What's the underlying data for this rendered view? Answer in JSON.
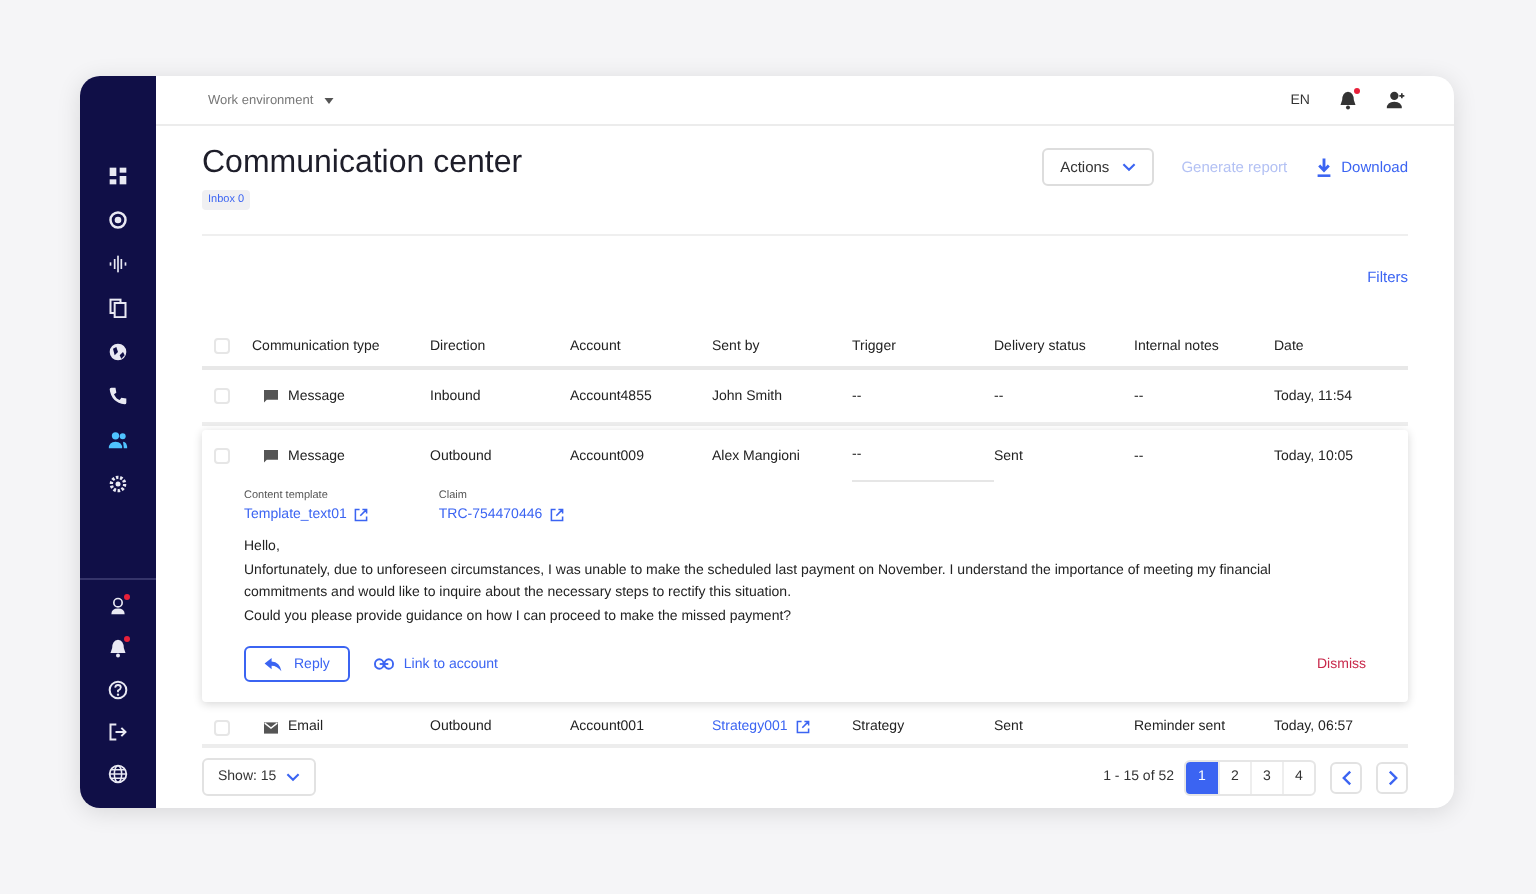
{
  "sidebar": {
    "items": [
      {
        "kind": "dashboard",
        "selected": false,
        "notification": false
      },
      {
        "kind": "target",
        "selected": false,
        "notification": false
      },
      {
        "kind": "audio",
        "selected": false,
        "notification": false
      },
      {
        "kind": "copy",
        "selected": false,
        "notification": false
      },
      {
        "kind": "globe",
        "selected": false,
        "notification": false
      },
      {
        "kind": "phone",
        "selected": false,
        "notification": false
      },
      {
        "kind": "users",
        "selected": true,
        "notification": false
      },
      {
        "kind": "gear",
        "selected": false,
        "notification": false
      }
    ],
    "bottom_items": [
      {
        "kind": "person",
        "selected": false,
        "notification": true
      },
      {
        "kind": "bell",
        "selected": false,
        "notification": true
      },
      {
        "kind": "help",
        "selected": false,
        "notification": false
      },
      {
        "kind": "logout",
        "selected": false,
        "notification": false
      },
      {
        "kind": "globe",
        "selected": false,
        "notification": false
      }
    ]
  },
  "top_bar": {
    "environment": "Work environment",
    "language": "EN",
    "notifications_dot": true
  },
  "header": {
    "title": "Communication center",
    "badge": "Inbox 0",
    "actions": "Actions",
    "generate_report": {
      "label": "Generate report",
      "disabled": true
    },
    "download": "Download"
  },
  "filters": "Filters",
  "table": {
    "all_checked": false,
    "columns": [
      "Communication type",
      "Direction",
      "Account",
      "Sent by",
      "Trigger",
      "Delivery status",
      "Internal notes",
      "Date"
    ],
    "rows": [
      {
        "kind": "message",
        "type": "Message",
        "direction": "Inbound",
        "account": "Account4855",
        "sent_by": {
          "text": "John Smith",
          "link": false
        },
        "trigger": "--",
        "delivery_status": "--",
        "internal_notes": "--",
        "date": "Today, 11:54",
        "checked": false,
        "expanded": false
      },
      {
        "kind": "message",
        "type": "Message",
        "direction": "Outbound",
        "account": "Account009",
        "sent_by": {
          "text": "Alex Mangioni",
          "link": false
        },
        "trigger": "--",
        "delivery_status": "Sent",
        "internal_notes": "--",
        "date": "Today, 10:05",
        "checked": false,
        "expanded": true,
        "details": {
          "fields": [
            {
              "label": "Content template",
              "value": "Template_text01"
            },
            {
              "label": "Claim",
              "value": "TRC-754470446"
            }
          ],
          "paragraphs": [
            "Hello,",
            "Unfortunately, due to unforeseen circumstances, I was unable to make the scheduled last payment on November. I understand the importance of meeting my financial commitments and would like to inquire about the necessary steps to rectify this situation.",
            "Could you please provide guidance on how I can proceed to make the missed payment?"
          ],
          "reply": "Reply",
          "link_to_account": "Link to account",
          "dismiss": "Dismiss"
        }
      },
      {
        "kind": "email",
        "type": "Email",
        "direction": "Outbound",
        "account": "Account001",
        "sent_by": {
          "text": "Strategy001",
          "link": true
        },
        "trigger": "Strategy",
        "delivery_status": "Sent",
        "internal_notes": "Reminder sent",
        "date": "Today, 06:57",
        "checked": false,
        "expanded": false
      }
    ]
  },
  "footer": {
    "show": "Show: 15",
    "range": "1 - 15 of 52",
    "pages": [
      {
        "label": "1",
        "selected": true
      },
      {
        "label": "2",
        "selected": false
      },
      {
        "label": "3",
        "selected": false
      },
      {
        "label": "4",
        "selected": false
      }
    ]
  }
}
